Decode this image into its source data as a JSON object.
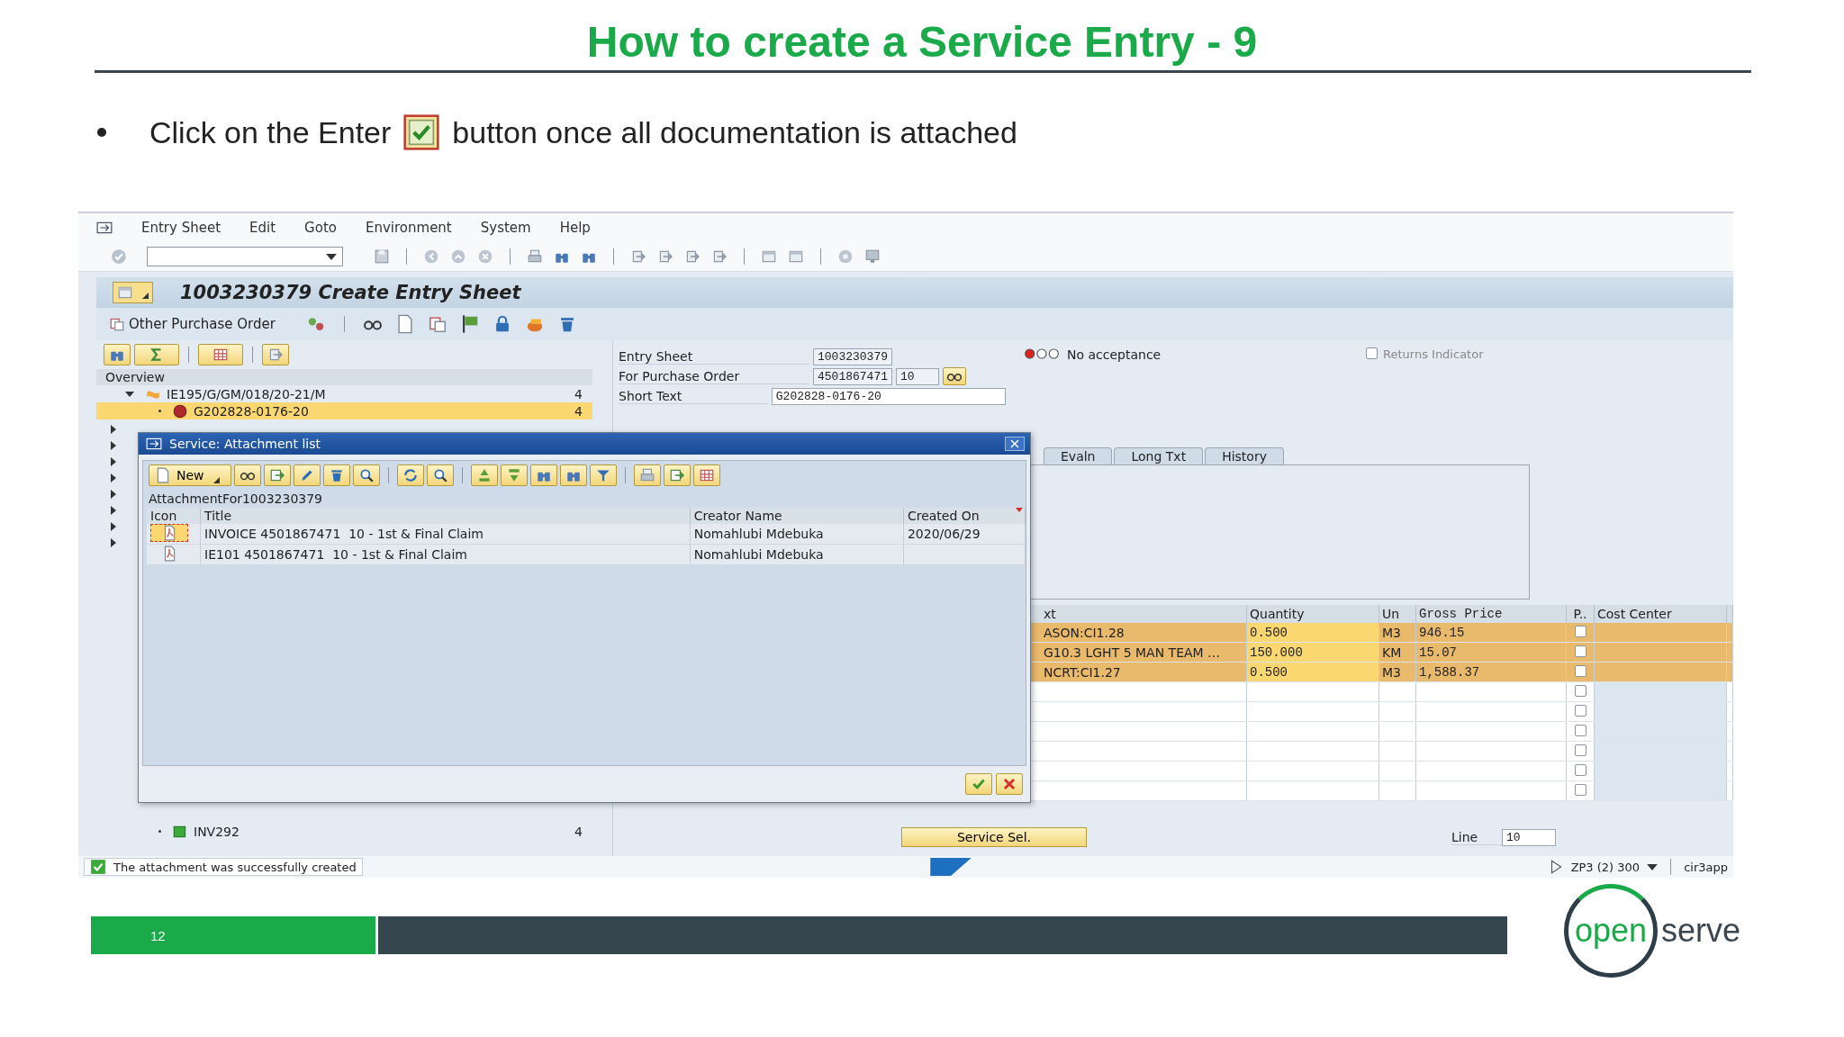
{
  "slide": {
    "title": "How to create a Service Entry - 9",
    "bullet_before": "Click on the Enter",
    "bullet_after": "button once all documentation is attached"
  },
  "sap": {
    "menu": [
      "Entry Sheet",
      "Edit",
      "Goto",
      "Environment",
      "System",
      "Help"
    ],
    "title": "1003230379 Create Entry Sheet",
    "app_button": "Other Purchase Order",
    "overview": {
      "heading": "Overview",
      "nodes": [
        {
          "label": "IE195/G/GM/018/20-21/M",
          "count": "4",
          "expanded": true,
          "selected": false,
          "children": [
            {
              "label": "G202828-0176-20",
              "count": "4",
              "selected": true
            }
          ]
        }
      ],
      "bottom_node": {
        "label": "INV292",
        "count": "4"
      }
    },
    "fields": [
      {
        "label": "Entry Sheet",
        "value": "1003230379"
      },
      {
        "label": "For Purchase Order",
        "value": "4501867471",
        "value_2": "10"
      },
      {
        "label": "Short Text",
        "value": "G202828-0176-20"
      }
    ],
    "acceptance": "No acceptance",
    "returns_indicator": {
      "label": "Returns Indicator",
      "checked": false
    },
    "tabs": [
      {
        "label": "Evaln",
        "selected": false
      },
      {
        "label": "Long Txt",
        "selected": false
      },
      {
        "label": "History",
        "selected": false
      }
    ],
    "services": {
      "columns": [
        "xt",
        "Quantity",
        "Un",
        "Gross Price",
        "P..",
        "Cost Center"
      ],
      "rows": [
        {
          "text": "ASON:CI1.28",
          "quantity": "0.500",
          "unit": "M3",
          "price": "946.15",
          "checked": false
        },
        {
          "text": "G10.3 LGHT 5 MAN TEAM …",
          "quantity": "150.000",
          "unit": "KM",
          "price": "15.07",
          "checked": false
        },
        {
          "text": "NCRT:CI1.27",
          "quantity": "0.500",
          "unit": "M3",
          "price": "1,588.37",
          "checked": false
        },
        {
          "checked": false
        },
        {
          "checked": false
        },
        {
          "checked": false
        },
        {
          "checked": false
        },
        {
          "checked": false
        },
        {
          "checked": false
        }
      ]
    },
    "service_sel": "Service Sel.",
    "line": {
      "label": "Line",
      "value": "10"
    },
    "status": {
      "message": "The attachment was successfully created",
      "system": "ZP3 (2) 300",
      "server": "cir3app"
    }
  },
  "dialog": {
    "title": "Service: Attachment list",
    "new_button": "New",
    "caption": "AttachmentFor1003230379",
    "columns": [
      "Icon",
      "Title",
      "Creator Name",
      "Created On"
    ],
    "rows": [
      {
        "title": "INVOICE 4501867471  10 - 1st & Final Claim",
        "creator": "Nomahlubi Mdebuka",
        "created_on": "2020/06/29",
        "selected": true
      },
      {
        "title": "IE101 4501867471  10 - 1st & Final Claim",
        "creator": "Nomahlubi Mdebuka",
        "selected": false
      }
    ]
  },
  "footer": {
    "page": "12",
    "logo_left": "open",
    "logo_right": "serve"
  }
}
